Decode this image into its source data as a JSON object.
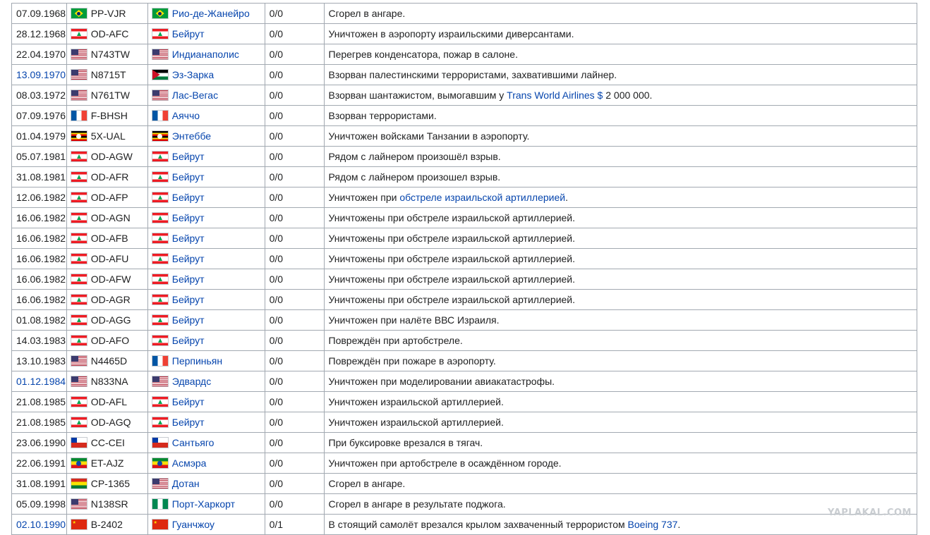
{
  "rows": [
    {
      "date": "07.09.1968",
      "date_link": false,
      "reg_flag": "br",
      "reg": "PP-VJR",
      "place_flag": "br",
      "place": "Рио-де-Жанейро",
      "casualties": "0/0",
      "desc": "Сгорел в ангаре."
    },
    {
      "date": "28.12.1968",
      "date_link": false,
      "reg_flag": "lb",
      "reg": "OD-AFC",
      "place_flag": "lb",
      "place": "Бейрут",
      "casualties": "0/0",
      "desc": "Уничтожен в аэропорту израильскими диверсантами."
    },
    {
      "date": "22.04.1970",
      "date_link": false,
      "reg_flag": "us",
      "reg": "N743TW",
      "place_flag": "us",
      "place": "Индианаполис",
      "casualties": "0/0",
      "desc": "Перегрев конденсатора, пожар в салоне."
    },
    {
      "date": "13.09.1970",
      "date_link": true,
      "reg_flag": "us",
      "reg": "N8715T",
      "place_flag": "jo",
      "place": "Эз-Зарка",
      "casualties": "0/0",
      "desc": "Взорван палестинскими террористами, захватившими лайнер."
    },
    {
      "date": "08.03.1972",
      "date_link": false,
      "reg_flag": "us",
      "reg": "N761TW",
      "place_flag": "us",
      "place": "Лас-Вегас",
      "casualties": "0/0",
      "desc_pre": "Взорван шантажистом, вымогавшим у ",
      "desc_link": "Trans World Airlines $",
      "desc_post": " 2 000 000."
    },
    {
      "date": "07.09.1976",
      "date_link": false,
      "reg_flag": "fr",
      "reg": "F-BHSH",
      "place_flag": "fr",
      "place": "Аяччо",
      "casualties": "0/0",
      "desc": "Взорван террористами."
    },
    {
      "date": "01.04.1979",
      "date_link": false,
      "reg_flag": "ug",
      "reg": "5X-UAL",
      "place_flag": "ug",
      "place": "Энтеббе",
      "casualties": "0/0",
      "desc": "Уничтожен войсками Танзании в аэропорту."
    },
    {
      "date": "05.07.1981",
      "date_link": false,
      "reg_flag": "lb",
      "reg": "OD-AGW",
      "place_flag": "lb",
      "place": "Бейрут",
      "casualties": "0/0",
      "desc": "Рядом с лайнером произошёл взрыв."
    },
    {
      "date": "31.08.1981",
      "date_link": false,
      "reg_flag": "lb",
      "reg": "OD-AFR",
      "place_flag": "lb",
      "place": "Бейрут",
      "casualties": "0/0",
      "desc": "Рядом с лайнером произошел взрыв."
    },
    {
      "date": "12.06.1982",
      "date_link": false,
      "reg_flag": "lb",
      "reg": "OD-AFP",
      "place_flag": "lb",
      "place": "Бейрут",
      "casualties": "0/0",
      "desc_pre": "Уничтожен при ",
      "desc_link": "обстреле израильской артиллерией",
      "desc_post": "."
    },
    {
      "date": "16.06.1982",
      "date_link": false,
      "reg_flag": "lb",
      "reg": "OD-AGN",
      "place_flag": "lb",
      "place": "Бейрут",
      "casualties": "0/0",
      "desc": "Уничтожены при обстреле израильской артиллерией."
    },
    {
      "date": "16.06.1982",
      "date_link": false,
      "reg_flag": "lb",
      "reg": "OD-AFB",
      "place_flag": "lb",
      "place": "Бейрут",
      "casualties": "0/0",
      "desc": "Уничтожены при обстреле израильской артиллерией."
    },
    {
      "date": "16.06.1982",
      "date_link": false,
      "reg_flag": "lb",
      "reg": "OD-AFU",
      "place_flag": "lb",
      "place": "Бейрут",
      "casualties": "0/0",
      "desc": "Уничтожены при обстреле израильской артиллерией."
    },
    {
      "date": "16.06.1982",
      "date_link": false,
      "reg_flag": "lb",
      "reg": "OD-AFW",
      "place_flag": "lb",
      "place": "Бейрут",
      "casualties": "0/0",
      "desc": "Уничтожены при обстреле израильской артиллерией."
    },
    {
      "date": "16.06.1982",
      "date_link": false,
      "reg_flag": "lb",
      "reg": "OD-AGR",
      "place_flag": "lb",
      "place": "Бейрут",
      "casualties": "0/0",
      "desc": "Уничтожены при обстреле израильской артиллерией."
    },
    {
      "date": "01.08.1982",
      "date_link": false,
      "reg_flag": "lb",
      "reg": "OD-AGG",
      "place_flag": "lb",
      "place": "Бейрут",
      "casualties": "0/0",
      "desc": "Уничтожен при налёте ВВС Израиля."
    },
    {
      "date": "14.03.1983",
      "date_link": false,
      "reg_flag": "lb",
      "reg": "OD-AFO",
      "place_flag": "lb",
      "place": "Бейрут",
      "casualties": "0/0",
      "desc": "Повреждён при артобстреле."
    },
    {
      "date": "13.10.1983",
      "date_link": false,
      "reg_flag": "us",
      "reg": "N4465D",
      "place_flag": "fr",
      "place": "Перпиньян",
      "casualties": "0/0",
      "desc": "Повреждён при пожаре в аэропорту."
    },
    {
      "date": "01.12.1984",
      "date_link": true,
      "reg_flag": "us",
      "reg": "N833NA",
      "place_flag": "us",
      "place": "Эдвардс",
      "casualties": "0/0",
      "desc": "Уничтожен при моделировании авиакатастрофы."
    },
    {
      "date": "21.08.1985",
      "date_link": false,
      "reg_flag": "lb",
      "reg": "OD-AFL",
      "place_flag": "lb",
      "place": "Бейрут",
      "casualties": "0/0",
      "desc": "Уничтожен израильской артиллерией."
    },
    {
      "date": "21.08.1985",
      "date_link": false,
      "reg_flag": "lb",
      "reg": "OD-AGQ",
      "place_flag": "lb",
      "place": "Бейрут",
      "casualties": "0/0",
      "desc": "Уничтожен израильской артиллерией."
    },
    {
      "date": "23.06.1990",
      "date_link": false,
      "reg_flag": "cl",
      "reg": "CC-CEI",
      "place_flag": "cl",
      "place": "Сантьяго",
      "casualties": "0/0",
      "desc": "При буксировке врезался в тягач."
    },
    {
      "date": "22.06.1991",
      "date_link": false,
      "reg_flag": "et",
      "reg": "ET-AJZ",
      "place_flag": "et",
      "place": "Асмэра",
      "casualties": "0/0",
      "desc": "Уничтожен при артобстреле в осаждённом городе."
    },
    {
      "date": "31.08.1991",
      "date_link": false,
      "reg_flag": "bo",
      "reg": "CP-1365",
      "place_flag": "us",
      "place": "Дотан",
      "casualties": "0/0",
      "desc": "Сгорел в ангаре."
    },
    {
      "date": "05.09.1998",
      "date_link": false,
      "reg_flag": "us",
      "reg": "N138SR",
      "place_flag": "ng",
      "place": "Порт-Харкорт",
      "casualties": "0/0",
      "desc": "Сгорел в ангаре в результате поджога."
    },
    {
      "date": "02.10.1990",
      "date_link": true,
      "reg_flag": "cn",
      "reg": "B-2402",
      "place_flag": "cn",
      "place": "Гуанчжоу",
      "casualties": "0/1",
      "desc_pre": "В стоящий самолёт врезался крылом захваченный террористом ",
      "desc_link": "Boeing 737",
      "desc_post": "."
    }
  ],
  "watermark": "YAPLAKAL.COM",
  "colors": {
    "link": "#0645ad",
    "border": "#a2a9b1",
    "text": "#202122"
  }
}
